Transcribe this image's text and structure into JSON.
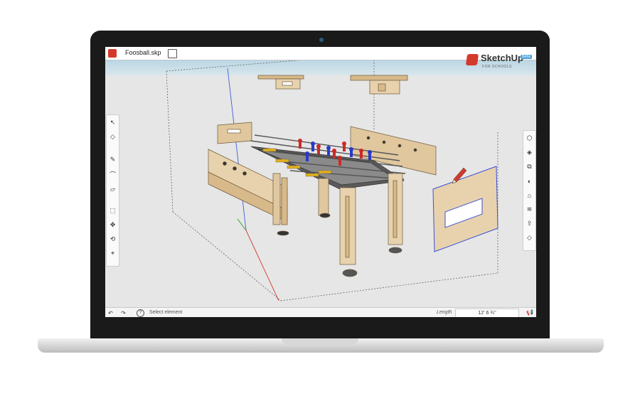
{
  "window": {
    "file_name": "Foosball.skp"
  },
  "brand": {
    "name": "SketchUp",
    "badge": "beta",
    "subtitle": "FOR SCHOOLS"
  },
  "left_toolbar": {
    "tools": [
      "select-icon",
      "eraser-icon",
      "pencil-icon",
      "arc-icon",
      "rectangle-icon",
      "push-pull-icon",
      "move-icon",
      "orbit-icon",
      "walk-icon"
    ]
  },
  "right_toolbar": {
    "tools": [
      "components-icon",
      "materials-icon",
      "entity-info-icon",
      "styles-icon",
      "scenes-icon",
      "layers-icon",
      "export-icon",
      "eraser-panel-icon"
    ]
  },
  "status": {
    "hint": "Select element",
    "length_label": "Length",
    "length_value": "12' 6 ¾\""
  },
  "colors": {
    "accent": "#d33a2c",
    "selection": "#3a4fd6",
    "wood": "#d8b98a"
  }
}
